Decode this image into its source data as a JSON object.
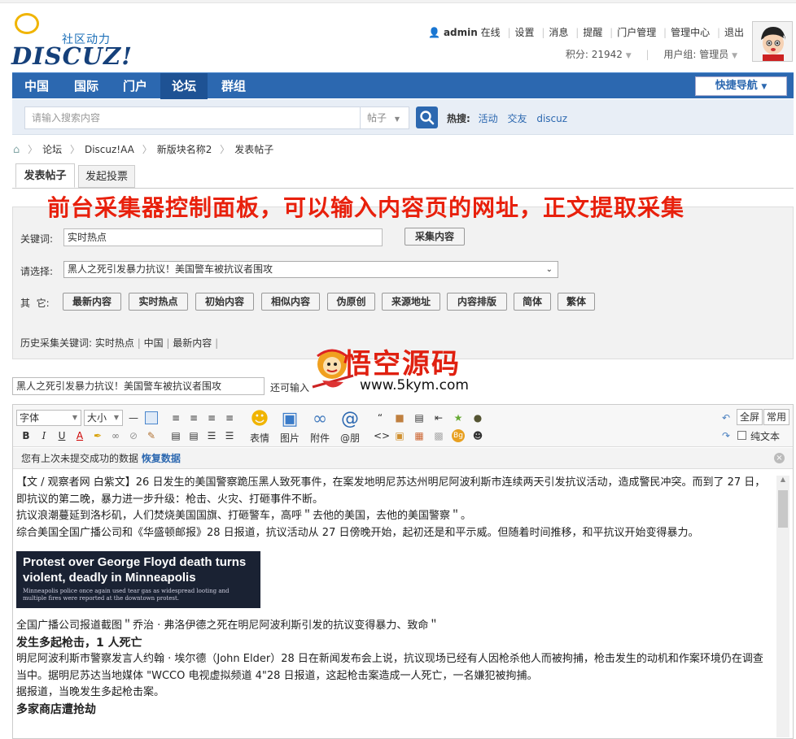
{
  "logo": {
    "tagline": "社区动力",
    "wordmark": "DISCUZ!"
  },
  "userbar": {
    "username": "admin",
    "online": "在线",
    "links": [
      "设置",
      "消息",
      "提醒",
      "门户管理",
      "管理中心",
      "退出"
    ],
    "points_label": "积分: 21942",
    "group_label": "用户组: 管理员"
  },
  "nav": {
    "items": [
      "中国",
      "国际",
      "门户",
      "论坛",
      "群组"
    ],
    "active": "论坛",
    "quick_nav": "快捷导航"
  },
  "search": {
    "placeholder": "请输入搜索内容",
    "type": "帖子",
    "hot_label": "热搜:",
    "hot_links": [
      "活动",
      "交友",
      "discuz"
    ]
  },
  "breadcrumb": [
    "论坛",
    "Discuz!AA",
    "新版块名称2",
    "发表帖子"
  ],
  "tabs": [
    "发表帖子",
    "发起投票"
  ],
  "banner": "前台采集器控制面板，可以输入内容页的网址，正文提取采集",
  "collector": {
    "keyword_label": "关键词:",
    "keyword_value": "实时热点",
    "collect_button": "采集内容",
    "select_label": "请选择:",
    "select_value": "黑人之死引发暴力抗议！美国警车被抗议者围攻",
    "other_label": "其  它:",
    "other_buttons": [
      "最新内容",
      "实时热点",
      "初始内容",
      "相似内容",
      "伪原创",
      "来源地址",
      "内容排版",
      "简体",
      "繁体"
    ],
    "history_label": "历史采集关键词:",
    "history_items": [
      "实时热点",
      "中国",
      "最新内容"
    ]
  },
  "url_row": {
    "value": "黑人之死引发暴力抗议！美国警车被抗议者围攻",
    "tip": "还可输入"
  },
  "watermark": {
    "title": "悟空源码",
    "url": "www.5kym.com"
  },
  "editor": {
    "font_select": "字体",
    "size_select": "大小",
    "big_tools": [
      "表情",
      "图片",
      "附件",
      "@朋"
    ],
    "fullscreen": "全屏",
    "common": "常用",
    "plaintext": "纯文本",
    "notice_text": "您有上次未提交成功的数据",
    "notice_link": "恢复数据"
  },
  "content": {
    "p1": "【文 / 观察者网 白紫文】26 日发生的美国警察跪压黑人致死事件，在案发地明尼苏达州明尼阿波利斯市连续两天引发抗议活动，造成警民冲突。而到了 27 日，即抗议的第二晚，暴力进一步升级：枪击、火灾、打砸事件不断。",
    "p2": "抗议浪潮蔓延到洛杉矶，人们焚烧美国国旗、打砸警车，高呼＂去他的美国，去他的美国警察＂。",
    "p3": "综合美国全国广播公司和《华盛顿邮报》28 日报道，抗议活动从 27 日傍晚开始，起初还是和平示威。但随着时间推移，和平抗议开始变得暴力。",
    "image_headline": "Protest over George Floyd death turns violent, deadly in Minneapolis",
    "image_sub": "Minneapolis police once again used tear gas as widespread looting and multiple fires were reported at the downtown protest.",
    "p4": "全国广播公司报道截图＂乔治 · 弗洛伊德之死在明尼阿波利斯引发的抗议变得暴力、致命＂",
    "h1": "发生多起枪击，1 人死亡",
    "p5": "明尼阿波利斯市警察发言人约翰 · 埃尔德（John Elder）28 日在新闻发布会上说，抗议现场已经有人因枪杀他人而被拘捕，枪击发生的动机和作案环境仍在调查当中。据明尼苏达当地媒体 \"WCCO 电视虚拟频道 4\"28 日报道，这起枪击案造成一人死亡，一名嫌犯被拘捕。",
    "p6": "据报道，当晚发生多起枪击案。",
    "h2": "多家商店遭抢劫"
  }
}
